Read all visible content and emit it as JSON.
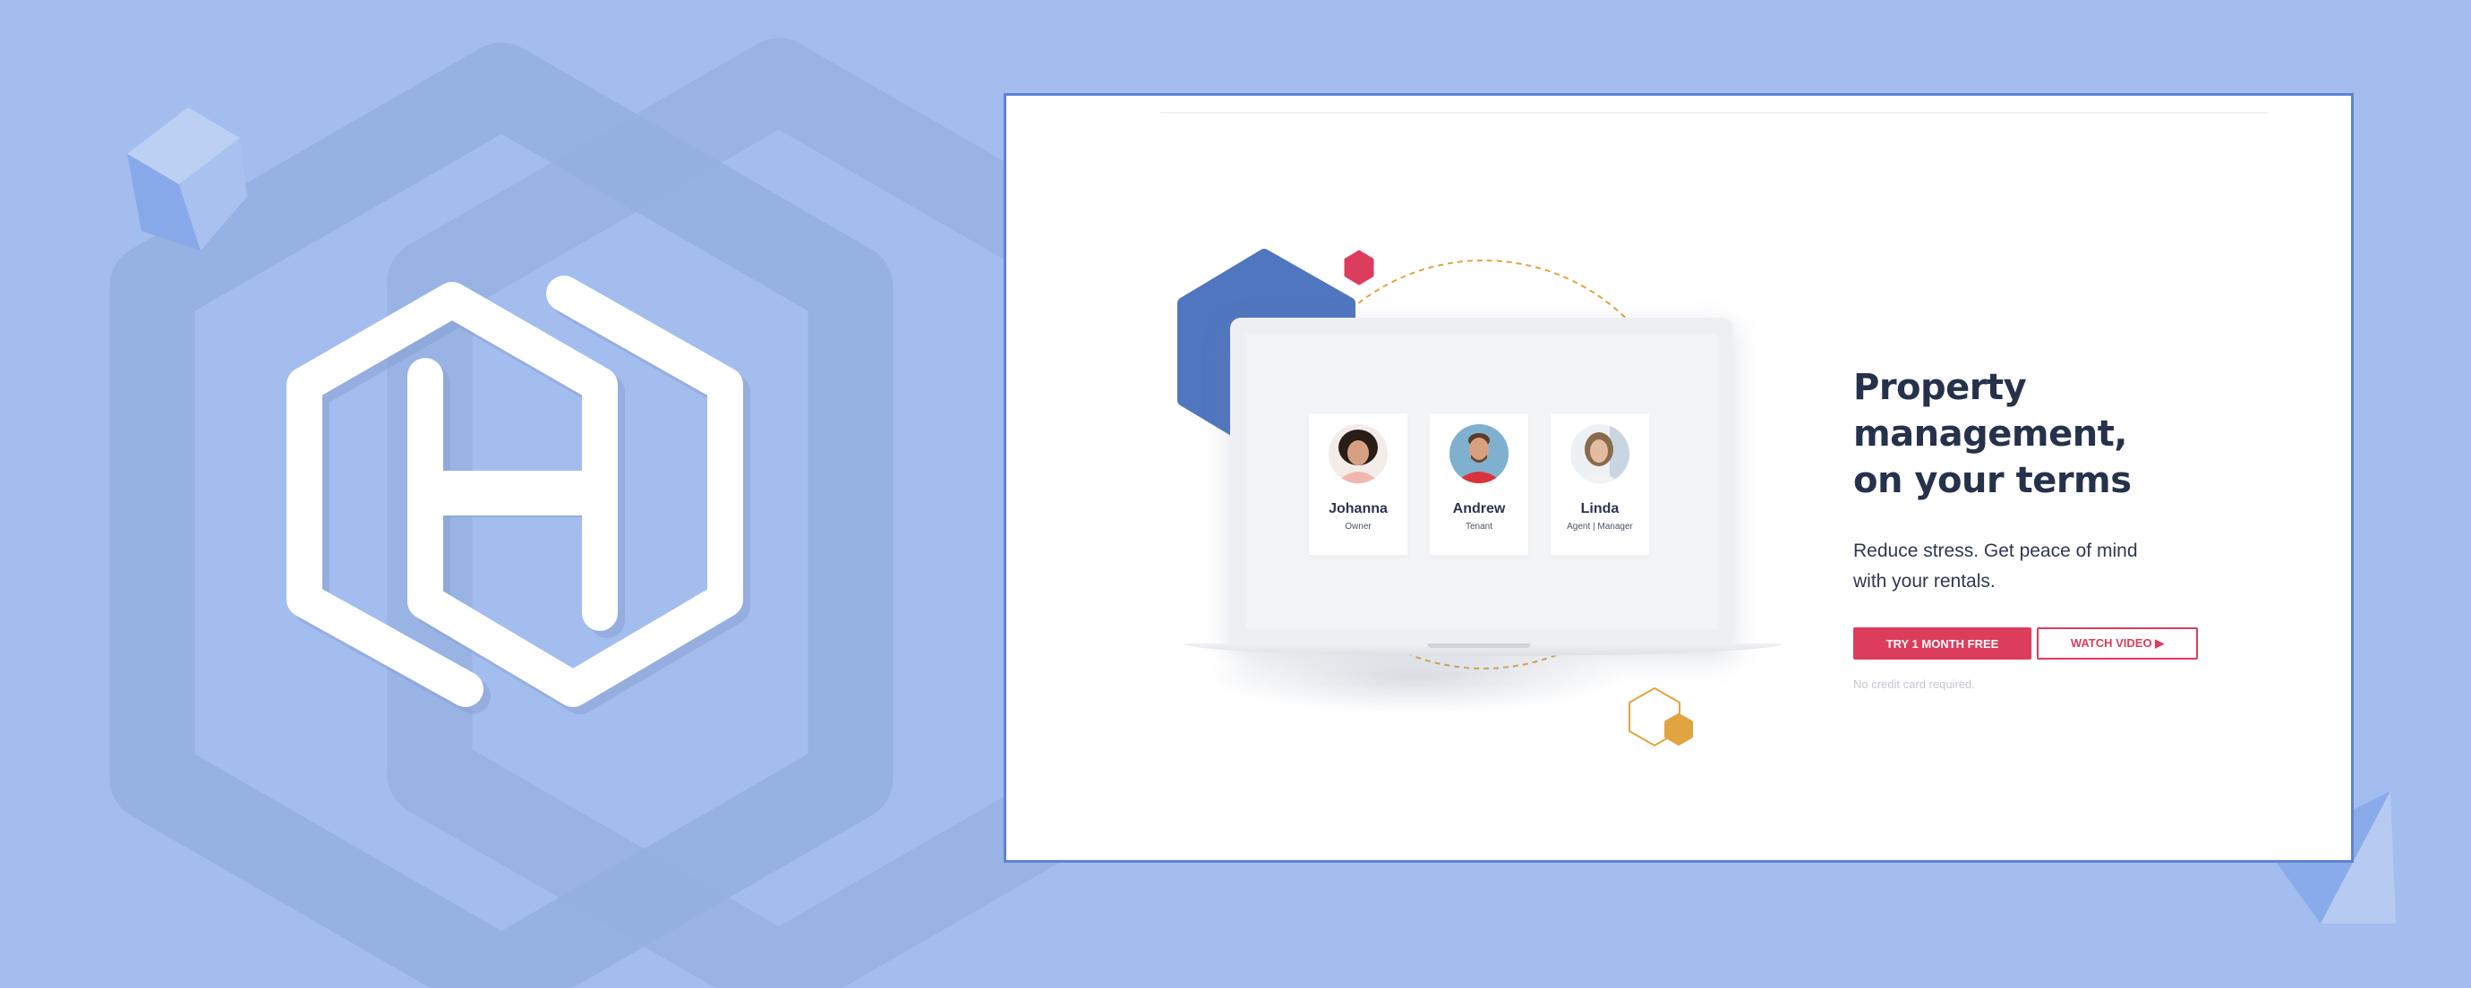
{
  "colors": {
    "background": "#a3bdee",
    "accent": "#dd3d5c",
    "brand_blue": "#4f76bf",
    "gold": "#e0a441",
    "heading": "#26324b"
  },
  "hero": {
    "headline_line1": "Property management,",
    "headline_line2": "on your terms",
    "subtext": "Reduce stress. Get peace of mind with your rentals.",
    "primary_button": "TRY 1 MONTH FREE",
    "secondary_button": "WATCH VIDEO ▶",
    "note": "No credit card required."
  },
  "profiles": [
    {
      "name": "Johanna",
      "role": "Owner"
    },
    {
      "name": "Andrew",
      "role": "Tenant"
    },
    {
      "name": "Linda",
      "role": "Agent | Manager"
    }
  ],
  "icons": {
    "logo": "hexagon-h-logo-icon",
    "play": "play-icon"
  }
}
